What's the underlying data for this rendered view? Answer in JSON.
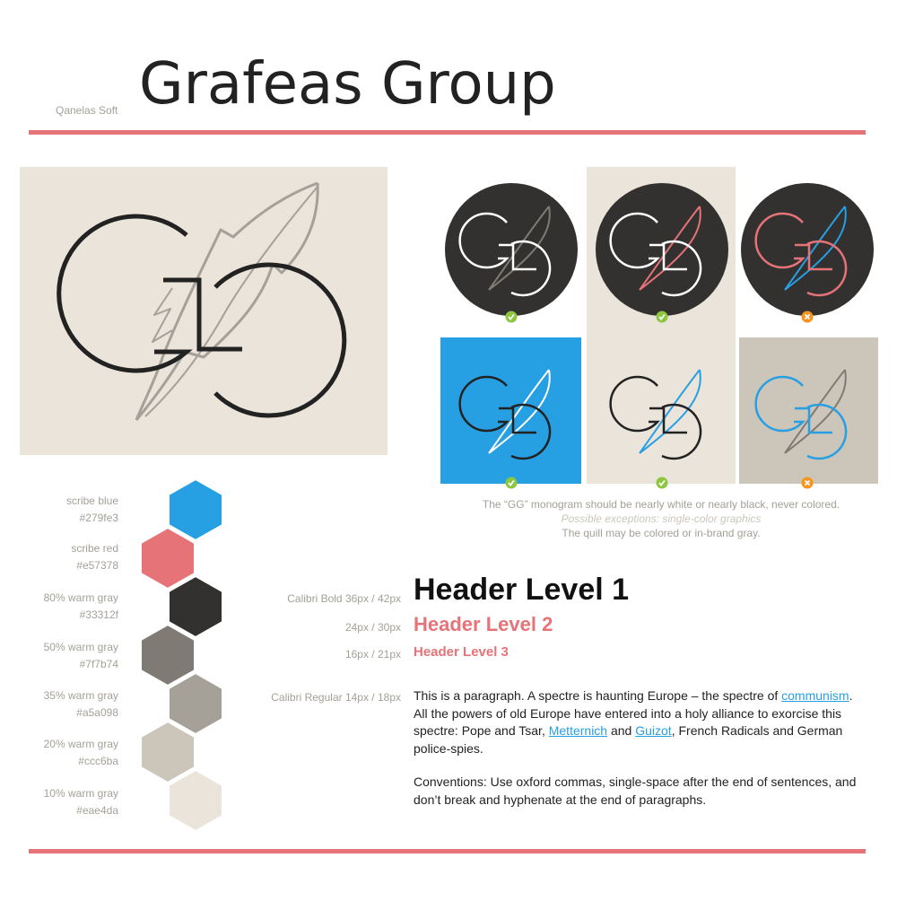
{
  "header": {
    "font_label": "Qanelas Soft",
    "title": "Grafeas Group"
  },
  "colors": {
    "scribe_blue": "#279fe3",
    "scribe_red": "#e57378",
    "warm_gray_80": "#33312f",
    "warm_gray_50": "#7f7b74",
    "warm_gray_35": "#a5a098",
    "warm_gray_20": "#ccc6ba",
    "warm_gray_10": "#eae4da",
    "ok_green": "#8dc63f",
    "bad_orange": "#f7941d"
  },
  "logo_variants": [
    {
      "background": "dark",
      "gg_color": "white",
      "quill_color": "gray",
      "status": "approved",
      "status_icon": "check-icon"
    },
    {
      "background": "dark",
      "gg_color": "white",
      "quill_color": "red",
      "status": "approved",
      "status_icon": "check-icon"
    },
    {
      "background": "dark",
      "gg_color": "red",
      "quill_color": "blue",
      "status": "rejected",
      "status_icon": "x-icon"
    },
    {
      "background": "blue",
      "gg_color": "black",
      "quill_color": "white",
      "status": "approved",
      "status_icon": "check-icon"
    },
    {
      "background": "light",
      "gg_color": "black",
      "quill_color": "blue",
      "status": "approved",
      "status_icon": "check-icon"
    },
    {
      "background": "gray",
      "gg_color": "blue",
      "quill_color": "gray",
      "status": "rejected",
      "status_icon": "x-icon"
    }
  ],
  "notes": {
    "line1": "The “GG” monogram should be nearly white or nearly black, never colored.",
    "line2": "Possible exceptions: single-color graphics",
    "line3": "The quill may be colored or in-brand gray."
  },
  "palette": [
    {
      "name": "scribe blue",
      "hex": "#279fe3"
    },
    {
      "name": "scribe red",
      "hex": "#e57378"
    },
    {
      "name": "80% warm gray",
      "hex": "#33312f"
    },
    {
      "name": "50% warm gray",
      "hex": "#7f7b74"
    },
    {
      "name": "35% warm gray",
      "hex": "#a5a098"
    },
    {
      "name": "20% warm gray",
      "hex": "#ccc6ba"
    },
    {
      "name": "10% warm gray",
      "hex": "#eae4da"
    }
  ],
  "typography": {
    "h1_label": "Calibri Bold 36px / 42px",
    "h1": "Header Level 1",
    "h2_label": "24px / 30px",
    "h2": "Header Level 2",
    "h3_label": "16px / 21px",
    "h3": "Header Level 3",
    "para_label": "Calibri Regular 14px / 18px",
    "para1": {
      "t1": "This is a paragraph. A spectre is haunting Europe – the spectre of ",
      "link1": "communism",
      "t2": ". All the powers of old Europe have entered into a holy alliance to exorcise this spectre: Pope and Tsar, ",
      "link2": "Metternich",
      "t3": " and ",
      "link3": "Guizot",
      "t4": ", French Radicals and German police-spies."
    },
    "para2": "Conventions: Use oxford commas, single-space after the end of sentences, and don’t break and hyphenate at the end of paragraphs."
  }
}
